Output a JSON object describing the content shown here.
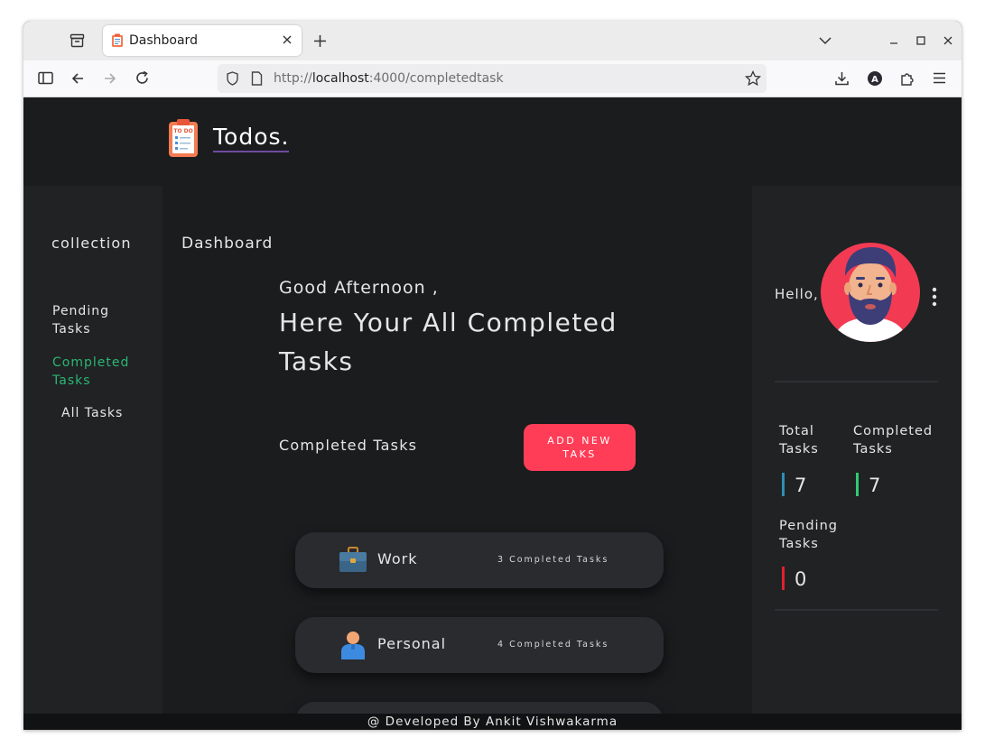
{
  "browser": {
    "tab_title": "Dashboard",
    "url_prefix": "http://",
    "url_host": "localhost",
    "url_rest": ":4000/completedtask"
  },
  "app": {
    "brand": "Todos.",
    "logo_text": "TO DO"
  },
  "sidebar": {
    "heading": "collection",
    "items": [
      {
        "label": "Pending Tasks",
        "active": false
      },
      {
        "label": "Completed Tasks",
        "active": true
      },
      {
        "label": "All Tasks",
        "active": false
      }
    ]
  },
  "main": {
    "title": "Dashboard",
    "greeting": "Good Afternoon ,",
    "headline": "Here Your All Completed Tasks",
    "section_label": "Completed Tasks",
    "add_button": "ADD NEW TAKS",
    "cards": [
      {
        "name": "Work",
        "count": "3 Completed Tasks",
        "icon": "briefcase-icon"
      },
      {
        "name": "Personal",
        "count": "4 Completed Tasks",
        "icon": "person-icon"
      }
    ]
  },
  "profile": {
    "hello": "Hello,",
    "stats": [
      {
        "label": "Total Tasks",
        "value": "7",
        "color": "#2e8fb4"
      },
      {
        "label": "Completed Tasks",
        "value": "7",
        "color": "#2ecc71"
      },
      {
        "label": "Pending Tasks",
        "value": "0",
        "color": "#e0222c"
      }
    ]
  },
  "footer": "@ Developed By Ankit Vishwakarma",
  "colors": {
    "accent": "#ff3d57",
    "active_link": "#2bb673",
    "background": "#1b1c1e",
    "panel": "#202224"
  }
}
